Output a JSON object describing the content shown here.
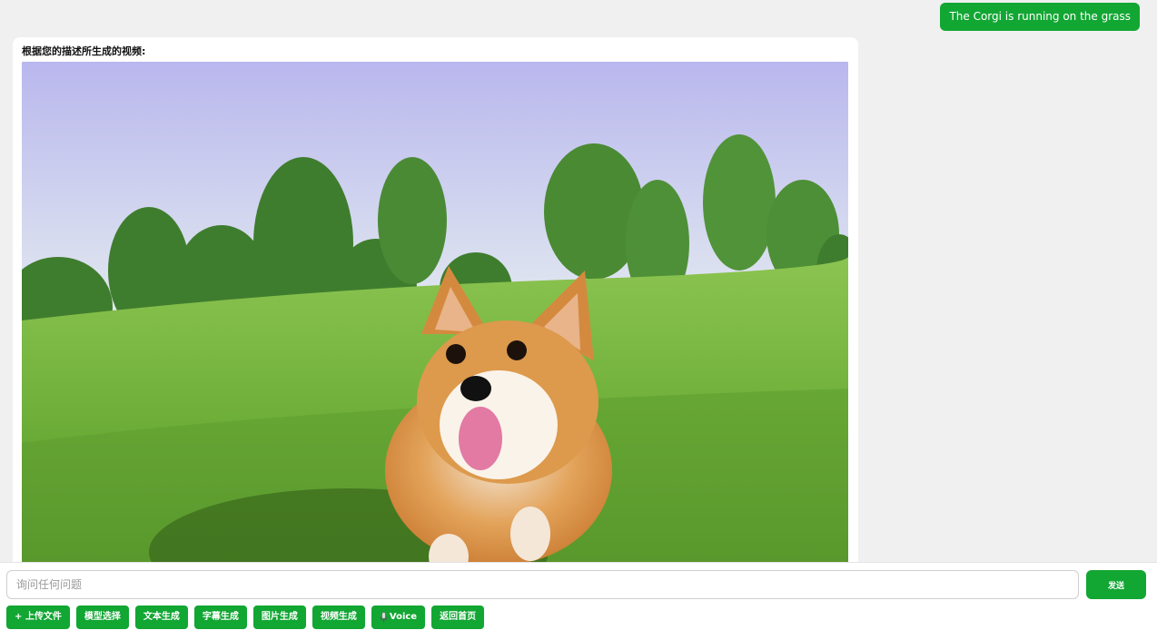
{
  "chat": {
    "user_message": "The Corgi is running on the grass",
    "bot_title": "根据您的描述所生成的视频:",
    "video_subject": "corgi running on grass"
  },
  "input": {
    "placeholder": "询问任何问题",
    "value": "",
    "send_label": "发送"
  },
  "toolbar": {
    "buttons": [
      {
        "label": "+ 上传文件"
      },
      {
        "label": "模型选择"
      },
      {
        "label": "文本生成"
      },
      {
        "label": "字幕生成"
      },
      {
        "label": "图片生成"
      },
      {
        "label": "视频生成"
      },
      {
        "label": "Voice",
        "icon": "microphone-icon"
      },
      {
        "label": "返回首页"
      }
    ]
  },
  "colors": {
    "accent": "#12a633",
    "page_bg": "#f0f0f0",
    "card_bg": "#ffffff"
  }
}
